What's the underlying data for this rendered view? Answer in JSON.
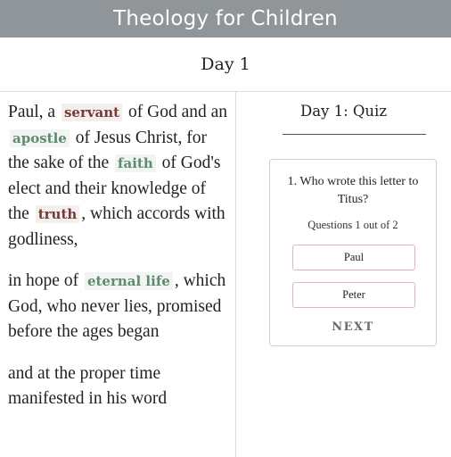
{
  "app": {
    "title": "Theology for Children"
  },
  "day": {
    "title": "Day 1"
  },
  "reading": {
    "p1": {
      "t1": "Paul, a",
      "h1": "servant",
      "t2": "of God and an",
      "h2": "apostle",
      "t3": "of Jesus Christ, for the sake of the",
      "h3": "faith",
      "t4": "of God's elect and their knowledge of the",
      "h4": "truth",
      "t5": ", which accords with godliness,"
    },
    "p2": {
      "t1": "in hope of",
      "h1": "eternal life",
      "t2": ", which God, who never lies, promised before the ages began"
    },
    "p3": {
      "t1": "and at the proper time manifested in his word"
    }
  },
  "quiz": {
    "title": "Day 1: Quiz",
    "question": "1. Who wrote this letter to Titus?",
    "progress": "Questions 1 out of 2",
    "options": [
      "Paul",
      "Peter"
    ],
    "next_label": "NEXT"
  },
  "colors": {
    "topbar": "#8f9598",
    "highlight_red": "#7a3a33",
    "highlight_green": "#5e8a6e",
    "option_border": "#e0b7b7"
  }
}
